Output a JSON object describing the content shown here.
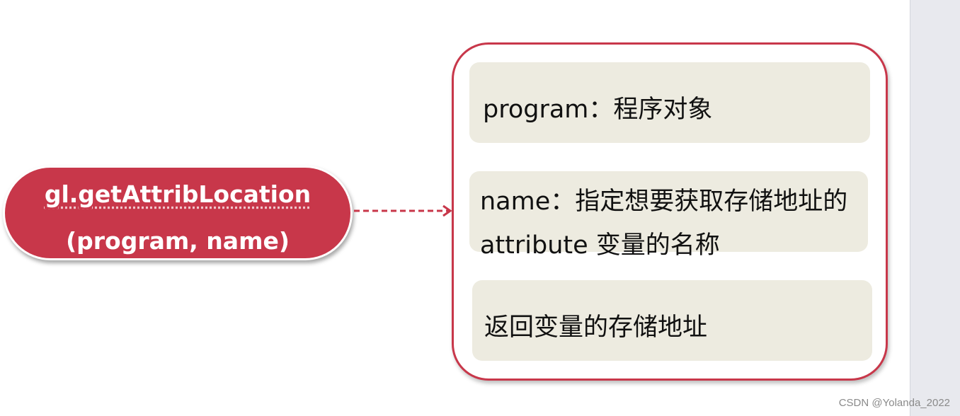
{
  "function": {
    "name": "gl.getAttribLocation",
    "args": "(program, name)"
  },
  "params": [
    {
      "text": "program：程序对象"
    },
    {
      "line1": "name：指定想要获取存储地址的",
      "line2": "attribute 变量的名称"
    },
    {
      "text": "返回变量的存储地址"
    }
  ],
  "colors": {
    "accent": "#c8374a",
    "param_bg": "#edebe0",
    "side_panel": "#e8e9ee"
  },
  "watermark": "CSDN @Yolanda_2022"
}
